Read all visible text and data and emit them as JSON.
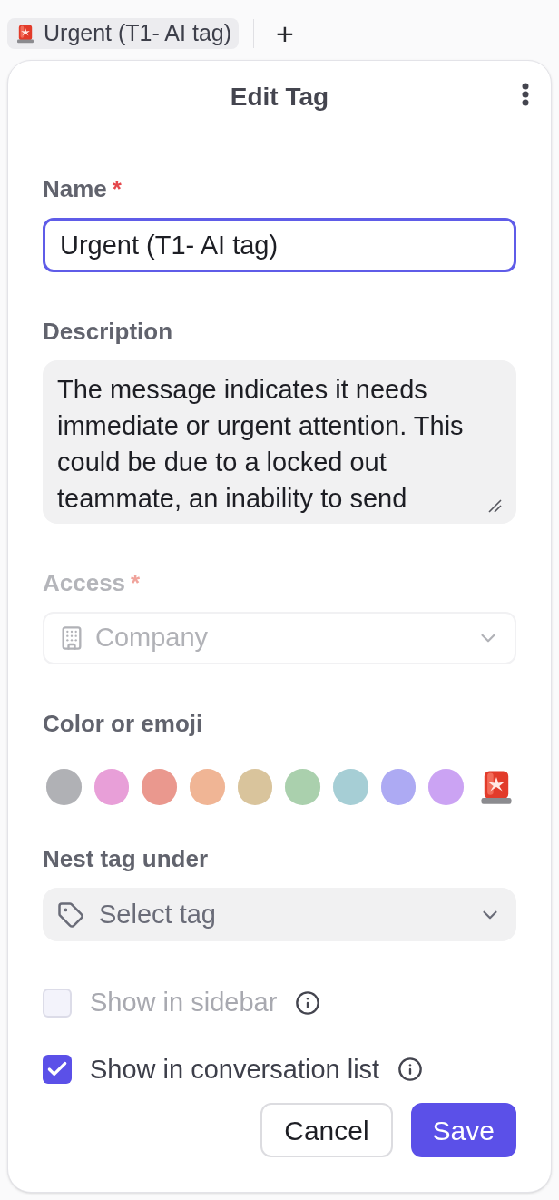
{
  "tab_bar": {
    "tag_chip": {
      "label": "Urgent (T1- AI tag)"
    },
    "add_label": "+"
  },
  "dialog": {
    "title": "Edit Tag",
    "name": {
      "label": "Name",
      "required_mark": "*",
      "value": "Urgent (T1- AI tag)",
      "focused": true
    },
    "description": {
      "label": "Description",
      "value": "The message indicates it needs immediate or urgent attention. This could be due to a locked out teammate, an inability to send"
    },
    "access": {
      "label": "Access",
      "required_mark": "*",
      "value": "Company",
      "disabled": true
    },
    "color_or_emoji": {
      "label": "Color or emoji",
      "swatches": [
        {
          "kind": "color",
          "color": "#b0b1b5"
        },
        {
          "kind": "color",
          "color": "#e89fd8"
        },
        {
          "kind": "color",
          "color": "#ea988e"
        },
        {
          "kind": "color",
          "color": "#f0b595"
        },
        {
          "kind": "color",
          "color": "#d9c49c"
        },
        {
          "kind": "color",
          "color": "#aad0ad"
        },
        {
          "kind": "color",
          "color": "#a6ced5"
        },
        {
          "kind": "color",
          "color": "#adaaf3"
        },
        {
          "kind": "color",
          "color": "#cba3f3"
        },
        {
          "kind": "emoji"
        }
      ]
    },
    "nest": {
      "label": "Nest tag under",
      "placeholder": "Select tag"
    },
    "options": [
      {
        "label": "Show in sidebar",
        "checked": false,
        "disabled": true
      },
      {
        "label": "Show in conversation list",
        "checked": true,
        "disabled": false
      }
    ],
    "buttons": [
      {
        "kind": "secondary",
        "label": "Cancel"
      },
      {
        "kind": "primary",
        "label": "Save"
      }
    ]
  }
}
